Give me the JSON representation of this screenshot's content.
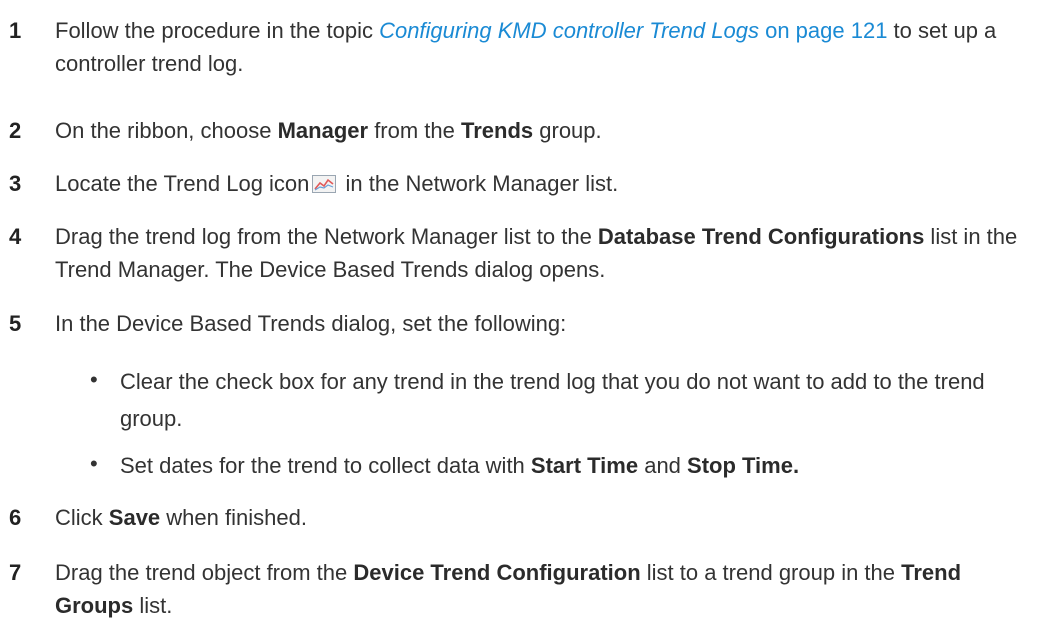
{
  "steps": [
    {
      "number": "1",
      "prefix": "Follow the procedure in the topic ",
      "link_italic": "Configuring KMD controller Trend Logs",
      "link_plain": " on page 121",
      "suffix": " to set up a controller trend log."
    },
    {
      "number": "2",
      "t1": "On the ribbon, choose ",
      "b1": "Manager",
      "t2": " from the ",
      "b2": "Trends",
      "t3": " group."
    },
    {
      "number": "3",
      "t1": "Locate the Trend Log icon",
      "icon": "trend-log-icon",
      "t2": " in the Network Manager list."
    },
    {
      "number": "4",
      "t1": "Drag the trend log from the Network Manager list to the ",
      "b1": "Database Trend Configurations",
      "t2": " list in the Trend Manager. The Device Based Trends dialog opens."
    },
    {
      "number": "5",
      "t1": "In the Device Based Trends dialog, set the following:",
      "bullets": [
        {
          "dot": "•",
          "text": "Clear the check box for any trend in the trend log that you do not want to add to the trend group."
        },
        {
          "dot": "•",
          "t1": "Set dates for the trend to collect data with ",
          "b1": "Start Time",
          "t2": " and ",
          "b2": "Stop Time."
        }
      ]
    },
    {
      "number": "6",
      "t1": "Click ",
      "b1": "Save",
      "t2": " when finished."
    },
    {
      "number": "7",
      "t1": "Drag the trend object from the ",
      "b1": "Device Trend Configuration",
      "t2": " list to a trend group in the ",
      "b2": "Trend Groups",
      "t3": " list."
    }
  ],
  "colors": {
    "text": "#333333",
    "link": "#1a8ad4",
    "icon_line": "#e05a5a"
  }
}
